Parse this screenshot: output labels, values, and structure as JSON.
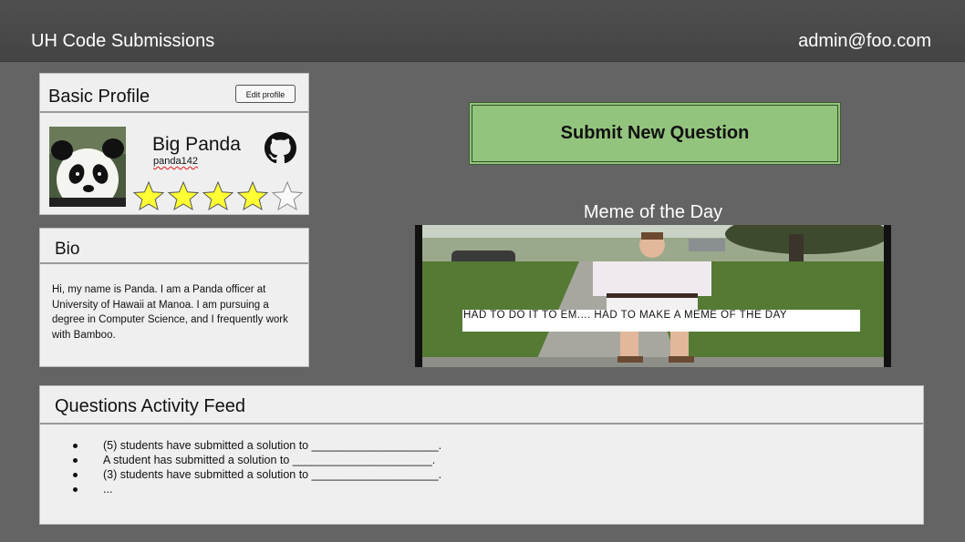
{
  "header": {
    "app_title": "UH Code Submissions",
    "user_email": "admin@foo.com"
  },
  "profile": {
    "title": "Basic Profile",
    "edit_label": "Edit profile",
    "display_name": "Big Panda",
    "username": "panda142",
    "rating": 4,
    "rating_max": 5,
    "star_color": "#ffff33"
  },
  "bio": {
    "title": "Bio",
    "text": "Hi, my name is Panda. I am a Panda officer at University of Hawaii at Manoa. I am pursuing a degree in Computer Science, and I frequently work with Bamboo."
  },
  "submit": {
    "label": "Submit New Question",
    "color": "#93c47d"
  },
  "meme": {
    "title": "Meme of the Day",
    "caption": "HAD TO DO IT TO EM.... HAD TO MAKE A MEME OF THE DAY"
  },
  "feed": {
    "title": "Questions Activity Feed",
    "items": [
      "(5) students have submitted a solution to ____________________.",
      "A student has submitted a solution to ______________________.",
      "(3) students have submitted a solution to ____________________.",
      "..."
    ]
  }
}
